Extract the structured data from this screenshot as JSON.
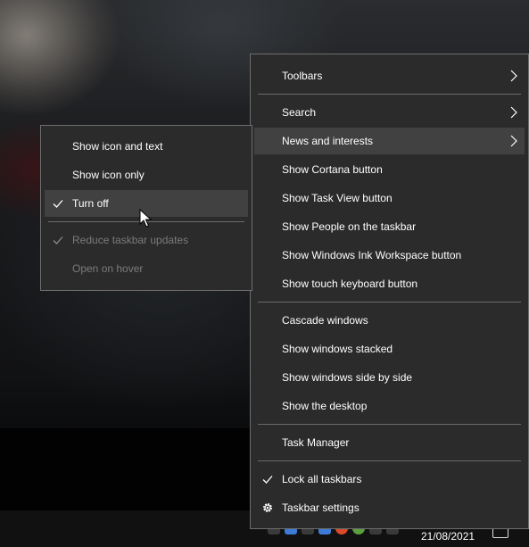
{
  "main_menu": {
    "items": [
      {
        "label": "Toolbars",
        "submenu": true
      },
      {
        "label": "Search",
        "submenu": true
      },
      {
        "label": "News and interests",
        "submenu": true,
        "highlighted": true
      },
      {
        "label": "Show Cortana button"
      },
      {
        "label": "Show Task View button"
      },
      {
        "label": "Show People on the taskbar"
      },
      {
        "label": "Show Windows Ink Workspace button"
      },
      {
        "label": "Show touch keyboard button"
      },
      {
        "label": "Cascade windows"
      },
      {
        "label": "Show windows stacked"
      },
      {
        "label": "Show windows side by side"
      },
      {
        "label": "Show the desktop"
      },
      {
        "label": "Task Manager"
      },
      {
        "label": "Lock all taskbars",
        "checked": true
      },
      {
        "label": "Taskbar settings",
        "icon": "gear-icon"
      }
    ]
  },
  "sub_menu": {
    "items": [
      {
        "label": "Show icon and text"
      },
      {
        "label": "Show icon only"
      },
      {
        "label": "Turn off",
        "checked": true,
        "highlighted": true
      },
      {
        "label": "Reduce taskbar updates",
        "checked": true,
        "disabled": true
      },
      {
        "label": "Open on hover",
        "disabled": true
      }
    ]
  },
  "taskbar": {
    "date": "21/08/2021"
  },
  "colors": {
    "menu_bg": "#2b2b2b",
    "menu_border": "#6e6e6e",
    "highlight": "#414141",
    "text": "#ffffff",
    "disabled_text": "#7b7b7b"
  }
}
